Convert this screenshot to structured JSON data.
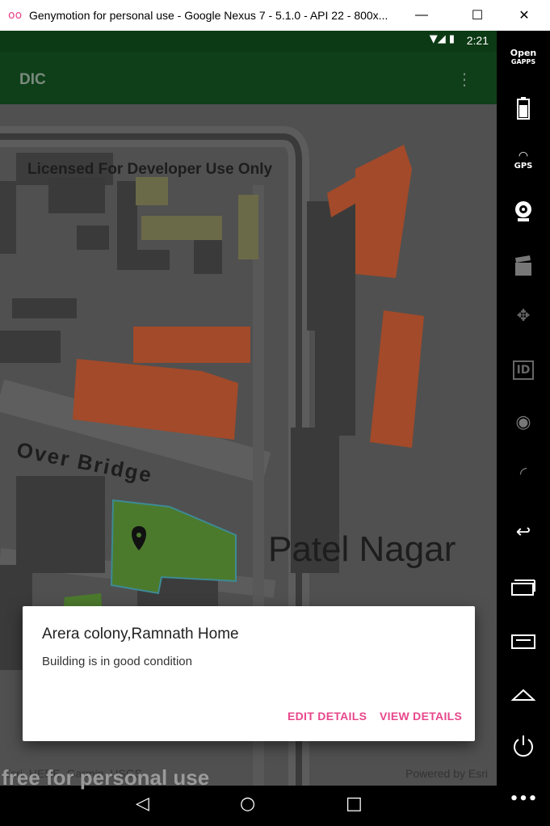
{
  "window": {
    "title": "Genymotion for personal use - Google Nexus 7 - 5.1.0 - API 22 - 800x...",
    "logo": "oo",
    "minimize": "—",
    "maximize": "☐",
    "close": "✕"
  },
  "status": {
    "time": "2:21",
    "icons": "▼◢ ▮"
  },
  "appbar": {
    "title": "DIC",
    "menu": "⋮"
  },
  "map": {
    "license_text": "Licensed For Developer Use Only",
    "road_label": "Over Bridge",
    "area_label": "Patel Nagar",
    "attribution_left": "Esri, HERE, Garmin, USGS",
    "attribution_right": "Powered by Esri"
  },
  "dialog": {
    "title": "Arera colony,Ramnath Home",
    "message": "Building is in good condition",
    "edit_label": "EDIT DETAILS",
    "view_label": "VIEW DETAILS"
  },
  "nav": {
    "back": "◁",
    "home": "○",
    "recents": "□"
  },
  "watermark": "free for personal use",
  "sidebar": {
    "opengapps_line1": "Open",
    "opengapps_line2": "GAPPS",
    "gps_label": "GPS",
    "id_label": "ID",
    "more": "•••"
  },
  "colors": {
    "accent": "#e8478b",
    "appbar": "#0f3f19",
    "building_orange": "#a24a2a",
    "building_green": "#4c7a2d"
  }
}
